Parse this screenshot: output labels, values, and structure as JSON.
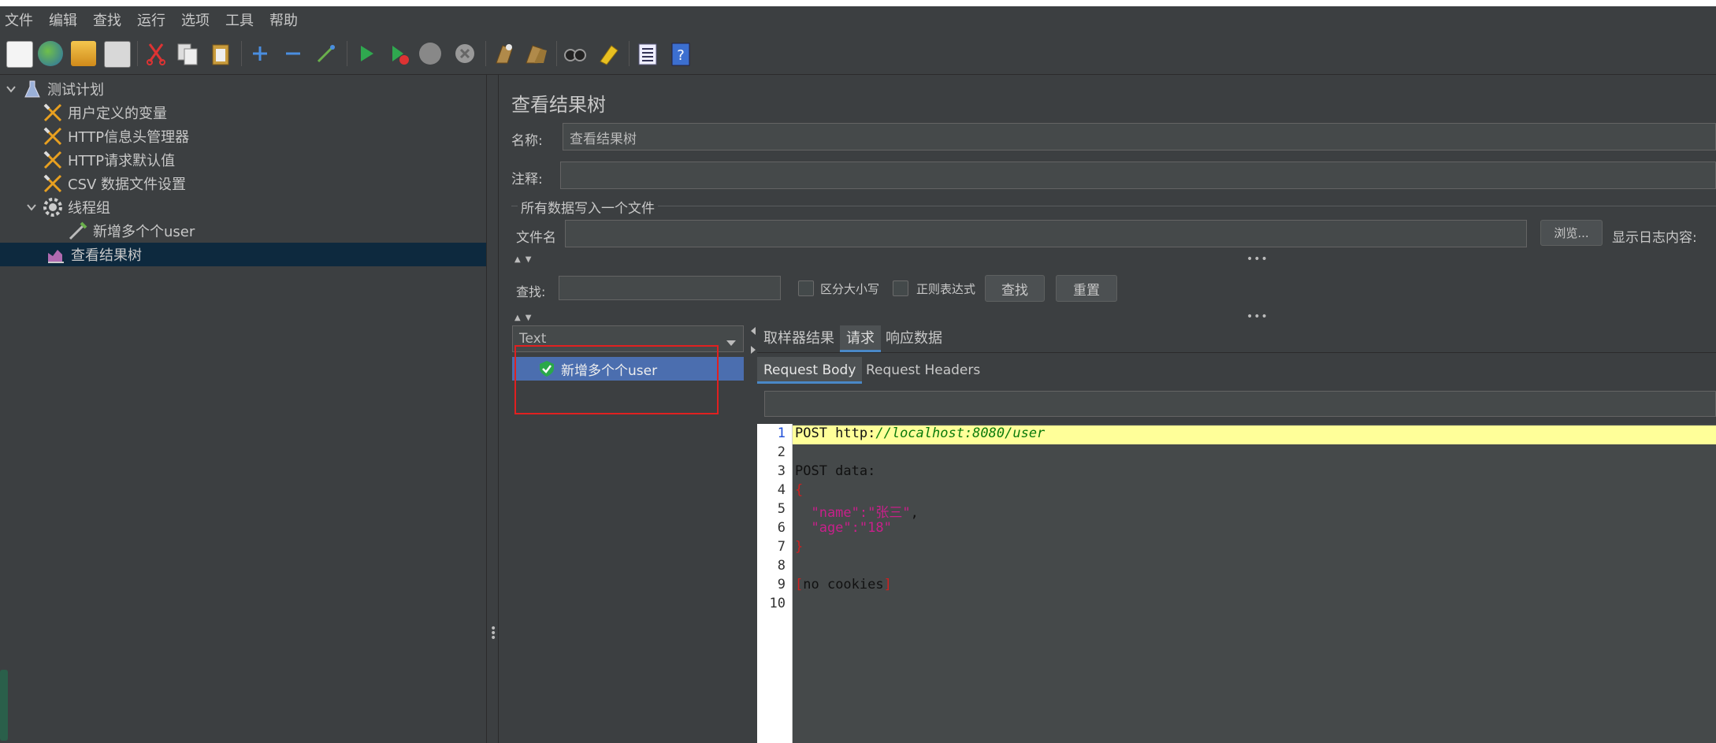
{
  "menu": [
    "文件",
    "编辑",
    "查找",
    "运行",
    "选项",
    "工具",
    "帮助"
  ],
  "toolbar": {
    "icons": [
      "new-plan-icon",
      "templates-icon",
      "open-icon",
      "save-icon",
      "cut-icon",
      "copy-icon",
      "paste-icon",
      "expand-icon",
      "collapse-icon",
      "toggle-icon",
      "start-icon",
      "start-no-pause-icon",
      "stop-icon",
      "shutdown-icon",
      "clear-icon",
      "clear-all-icon",
      "search-icon",
      "reset-search-icon",
      "function-helper-icon",
      "help-icon"
    ]
  },
  "tree": {
    "items": [
      {
        "label": "测试计划",
        "icon": "flask-icon"
      },
      {
        "label": "用户定义的变量",
        "icon": "wrench-icon"
      },
      {
        "label": "HTTP信息头管理器",
        "icon": "wrench-icon"
      },
      {
        "label": "HTTP请求默认值",
        "icon": "wrench-icon"
      },
      {
        "label": "CSV 数据文件设置",
        "icon": "wrench-icon"
      },
      {
        "label": "线程组",
        "icon": "gear-icon"
      },
      {
        "label": "新增多个个user",
        "icon": "pipette-icon"
      },
      {
        "label": "查看结果树",
        "icon": "chart-icon"
      }
    ]
  },
  "panel": {
    "title": "查看结果树",
    "name_label": "名称:",
    "name_value": "查看结果树",
    "comment_label": "注释:",
    "comment_value": "",
    "file_section": "所有数据写入一个文件",
    "filename_label": "文件名",
    "filename_value": "",
    "browse_button": "浏览...",
    "log_label": "显示日志内容:",
    "search_label": "查找:",
    "search_value": "",
    "case_label": "区分大小写",
    "regex_label": "正则表达式",
    "find_button": "查找",
    "reset_button": "重置"
  },
  "results": {
    "renderer": "Text",
    "samples": [
      {
        "label": "新增多个个user",
        "status": "success"
      }
    ]
  },
  "tabs": [
    "取样器结果",
    "请求",
    "响应数据"
  ],
  "active_tab": "请求",
  "subtabs": [
    "Request Body",
    "Request Headers"
  ],
  "active_subtab": "Request Body",
  "request_search_value": "",
  "code": {
    "line_numbers": [
      "1",
      "2",
      "3",
      "4",
      "5",
      "6",
      "7",
      "8",
      "9",
      "10"
    ],
    "line1_method": "POST http:",
    "line1_url": "//localhost:8080/user",
    "line3": "POST data:",
    "line4": "{",
    "line5_key": "  \"name\":",
    "line5_val": "\"张三\"",
    "line5_comma": ",",
    "line6_key": "  \"age\":",
    "line6_val": "\"18\"",
    "line7": "}",
    "line9_open": "[",
    "line9_text": "no cookies",
    "line9_close": "]"
  },
  "colors": {
    "background": "#3c3f41",
    "selection": "#4b6eaf",
    "tree_selection": "#0d293e",
    "annotation_box": "#e02020",
    "highlight_line": "#ffff99",
    "url_color": "#0a7a0a",
    "json_string": "#c8208a",
    "bracket_red": "#d02020"
  }
}
